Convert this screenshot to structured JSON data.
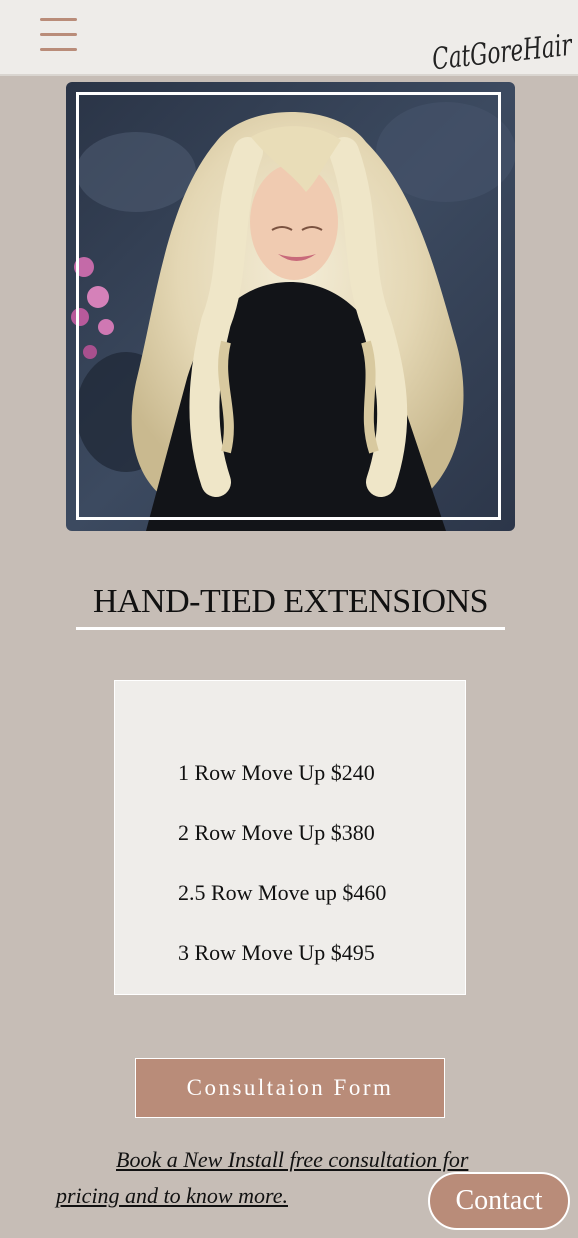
{
  "header": {
    "menu_icon": "hamburger-menu-icon",
    "logo_text": "CatGoreHair"
  },
  "hero": {
    "image": "photo of woman with long wavy platinum blonde hair extensions"
  },
  "section": {
    "title": "HAND-TIED EXTENSIONS"
  },
  "prices": [
    "1 Row Move Up $240",
    "2 Row Move Up $380",
    "2.5 Row Move up $460",
    "3 Row Move Up $495"
  ],
  "consultation": {
    "button_label": "Consultaion Form",
    "link_text": "Book a New Install free consultation for pricing and to know more."
  },
  "contact": {
    "button_label": "Contact"
  },
  "colors": {
    "background": "#c6bdb6",
    "topbar": "#eeece9",
    "accent": "#b98c79",
    "card": "#efedea"
  }
}
